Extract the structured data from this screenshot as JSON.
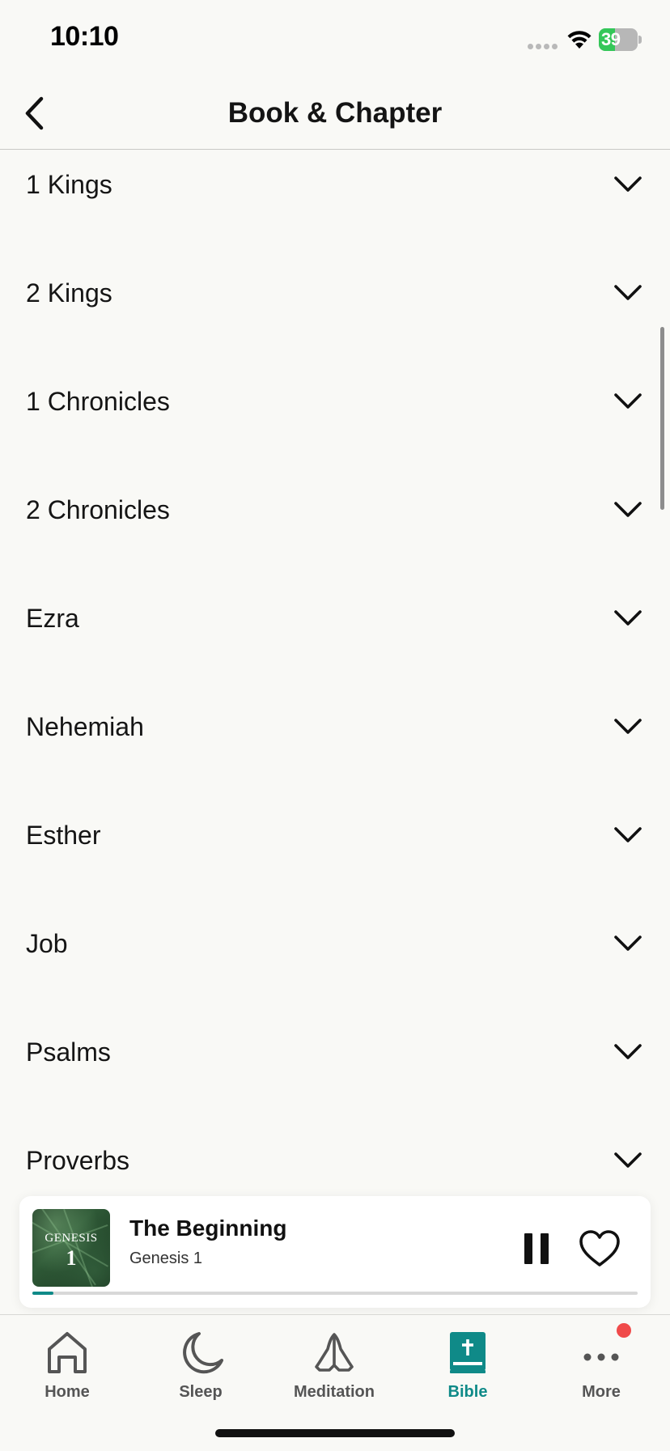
{
  "status_bar": {
    "time": "10:10",
    "battery_level": "39",
    "battery_color": "#34c759",
    "icons": [
      "cellular-dots-icon",
      "wifi-icon",
      "battery-charging-icon"
    ]
  },
  "header": {
    "title": "Book & Chapter",
    "back_icon": "chevron-left-icon"
  },
  "books": [
    {
      "label": "1 Kings"
    },
    {
      "label": "2 Kings"
    },
    {
      "label": "1 Chronicles"
    },
    {
      "label": "2 Chronicles"
    },
    {
      "label": "Ezra"
    },
    {
      "label": "Nehemiah"
    },
    {
      "label": "Esther"
    },
    {
      "label": "Job"
    },
    {
      "label": "Psalms"
    },
    {
      "label": "Proverbs"
    }
  ],
  "player": {
    "artwork_book": "GENESIS",
    "artwork_chapter": "1",
    "title": "The Beginning",
    "subtitle": "Genesis 1",
    "progress_fraction": 0.035,
    "accent_color": "#0f8a88",
    "pause_icon": "pause-icon",
    "favorite_icon": "heart-outline-icon"
  },
  "tabs": [
    {
      "label": "Home",
      "icon": "home-icon",
      "active": false
    },
    {
      "label": "Sleep",
      "icon": "moon-icon",
      "active": false
    },
    {
      "label": "Meditation",
      "icon": "praying-hands-icon",
      "active": false
    },
    {
      "label": "Bible",
      "icon": "bible-icon",
      "active": true
    },
    {
      "label": "More",
      "icon": "more-dots-icon",
      "active": false,
      "badge": true
    }
  ]
}
